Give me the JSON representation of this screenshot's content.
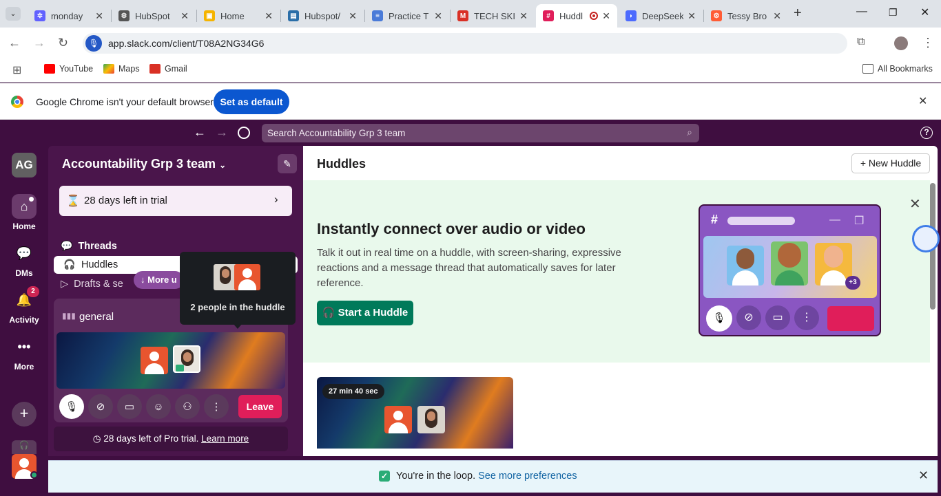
{
  "browser": {
    "tabs": [
      {
        "title": "monday",
        "color": "#6161ff",
        "icon": "monday-icon"
      },
      {
        "title": "HubSpot",
        "color": "#333333",
        "icon": "hubspot-icon"
      },
      {
        "title": "Home",
        "color": "#f5b400",
        "icon": "home-icon"
      },
      {
        "title": "Hubspot/",
        "color": "#2a6ea8",
        "icon": "hubspot-icon"
      },
      {
        "title": "Practice T",
        "color": "#4a7bd8",
        "icon": "docs-icon"
      },
      {
        "title": "TECH SKIL",
        "color": "#d93025",
        "icon": "gmail-icon"
      },
      {
        "title": "Huddl",
        "color": "#e01e5a",
        "icon": "slack-icon"
      },
      {
        "title": "DeepSeek",
        "color": "#4d6bfe",
        "icon": "deepseek-icon"
      },
      {
        "title": "Tessy Bro",
        "color": "#ff5c35",
        "icon": "hubspot-icon"
      }
    ],
    "url": "app.slack.com/client/T08A2NG34G6",
    "bookmarks": [
      {
        "label": "YouTube",
        "color": "#ff0000"
      },
      {
        "label": "Maps",
        "color": "#34a853"
      },
      {
        "label": "Gmail",
        "color": "#d93025"
      }
    ],
    "all_bookmarks": "All Bookmarks",
    "infobar_text": "Google Chrome isn't your default browser",
    "set_default": "Set as default"
  },
  "slack": {
    "search_placeholder": "Search Accountability Grp 3 team",
    "workspace_initials": "AG",
    "workspace_name": "Accountability Grp 3 team",
    "rail": [
      {
        "label": "Home"
      },
      {
        "label": "DMs"
      },
      {
        "label": "Activity",
        "badge": "2"
      },
      {
        "label": "More"
      }
    ],
    "trial_banner": "28 days left in trial",
    "nav": [
      {
        "label": "Threads"
      },
      {
        "label": "Huddles"
      },
      {
        "label": "Drafts & se"
      }
    ],
    "more_unread": "More u",
    "tooltip_text": "2 people in the huddle",
    "channel_name": "general",
    "leave_label": "Leave",
    "pro_trial_text": "28 days left of Pro trial.",
    "learn_more": "Learn more",
    "main_title": "Huddles",
    "new_huddle": "New Huddle",
    "hero_heading": "Instantly connect over audio or video",
    "hero_body": "Talk it out in real time on a huddle, with screen-sharing, expressive reactions and a message thread that automatically saves for later reference.",
    "start_huddle": "Start a Huddle",
    "illustration_badge": "+3",
    "huddle_duration": "27 min 40 sec",
    "loop_text": "You're in the loop.",
    "loop_link": "See more preferences"
  }
}
